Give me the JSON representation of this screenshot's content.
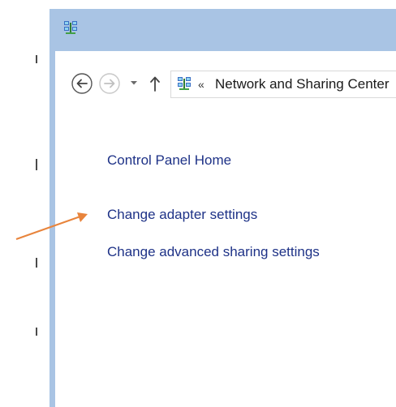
{
  "window": {
    "title_icon": "network-icon",
    "titlebar_color": "#a9c4e4"
  },
  "navigation": {
    "back_icon": "back-arrow-icon",
    "forward_icon": "forward-arrow-icon",
    "recent_icon": "chevron-down-icon",
    "up_icon": "up-arrow-icon",
    "address": {
      "icon": "network-icon",
      "chevron": "«",
      "path_text": "Network and Sharing Center"
    }
  },
  "left_pane": {
    "links": [
      {
        "label": "Control Panel Home"
      },
      {
        "label": "Change adapter settings"
      },
      {
        "label": "Change advanced sharing settings"
      }
    ],
    "link_color": "#1e3287"
  },
  "annotation": {
    "arrow_color": "#e8843c",
    "target": "Change adapter settings"
  }
}
